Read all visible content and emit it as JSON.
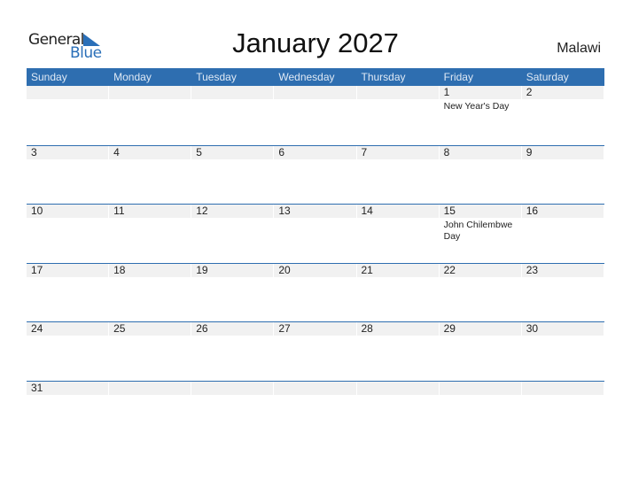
{
  "logo": {
    "general": "General",
    "blue": "Blue",
    "color": "#2a6fb8"
  },
  "title": "January 2027",
  "country": "Malawi",
  "header_color": "#2e6eb0",
  "days_of_week": [
    "Sunday",
    "Monday",
    "Tuesday",
    "Wednesday",
    "Thursday",
    "Friday",
    "Saturday"
  ],
  "weeks": [
    [
      {
        "d": ""
      },
      {
        "d": ""
      },
      {
        "d": ""
      },
      {
        "d": ""
      },
      {
        "d": ""
      },
      {
        "d": "1",
        "h": "New Year's Day"
      },
      {
        "d": "2"
      }
    ],
    [
      {
        "d": "3"
      },
      {
        "d": "4"
      },
      {
        "d": "5"
      },
      {
        "d": "6"
      },
      {
        "d": "7"
      },
      {
        "d": "8"
      },
      {
        "d": "9"
      }
    ],
    [
      {
        "d": "10"
      },
      {
        "d": "11"
      },
      {
        "d": "12"
      },
      {
        "d": "13"
      },
      {
        "d": "14"
      },
      {
        "d": "15",
        "h": "John Chilembwe Day"
      },
      {
        "d": "16"
      }
    ],
    [
      {
        "d": "17"
      },
      {
        "d": "18"
      },
      {
        "d": "19"
      },
      {
        "d": "20"
      },
      {
        "d": "21"
      },
      {
        "d": "22"
      },
      {
        "d": "23"
      }
    ],
    [
      {
        "d": "24"
      },
      {
        "d": "25"
      },
      {
        "d": "26"
      },
      {
        "d": "27"
      },
      {
        "d": "28"
      },
      {
        "d": "29"
      },
      {
        "d": "30"
      }
    ],
    [
      {
        "d": "31"
      },
      {
        "d": ""
      },
      {
        "d": ""
      },
      {
        "d": ""
      },
      {
        "d": ""
      },
      {
        "d": ""
      },
      {
        "d": ""
      }
    ]
  ]
}
